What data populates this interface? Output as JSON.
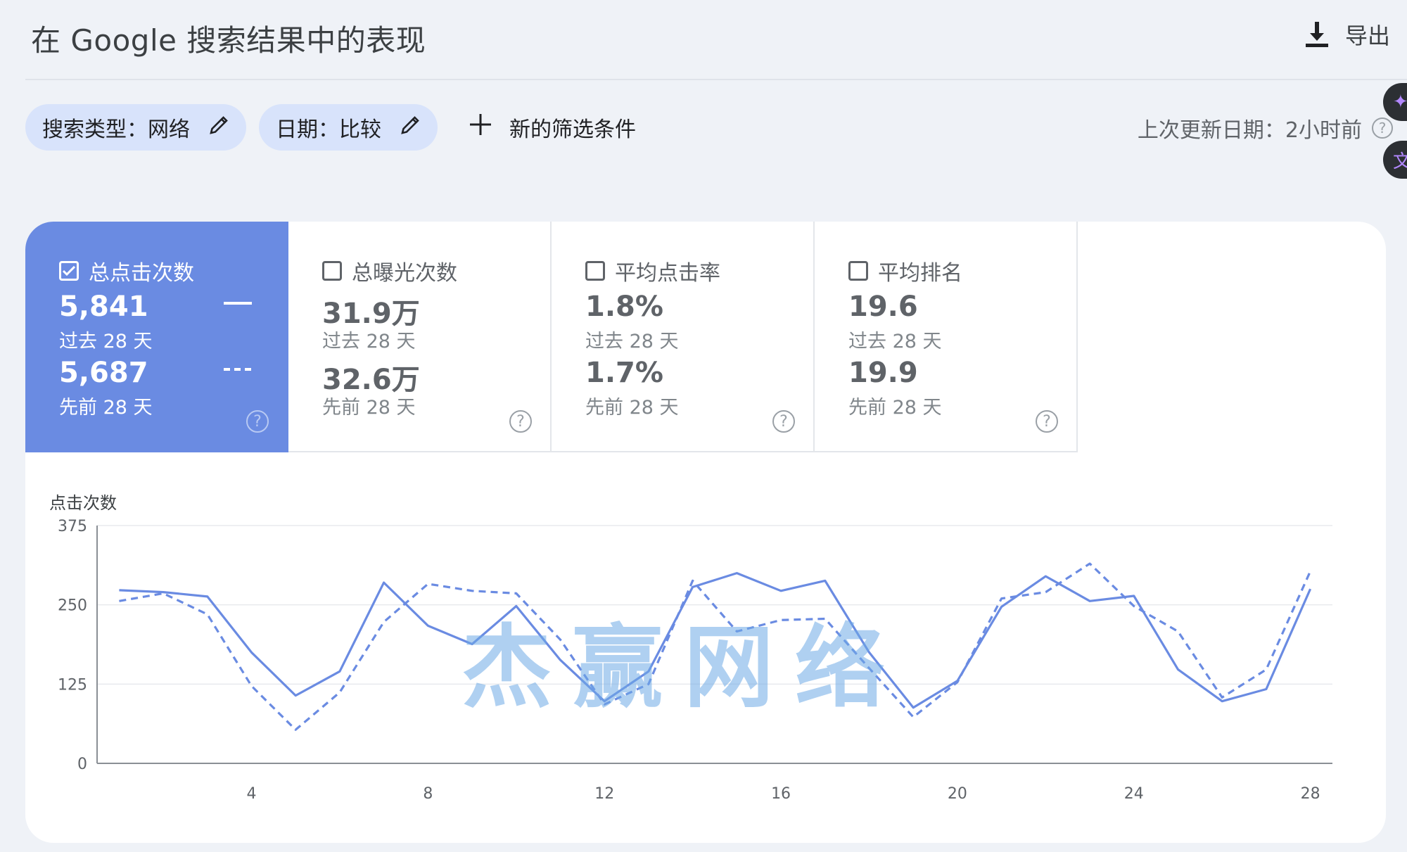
{
  "header": {
    "title": "在 Google 搜索结果中的表现",
    "export_label": "导出",
    "export_icon": "download-icon"
  },
  "filters": {
    "search_type_label": "搜索类型：网络",
    "date_label": "日期：比较",
    "add_filter_label": "新的筛选条件",
    "last_update_label": "上次更新日期：2小时前"
  },
  "metrics": [
    {
      "label": "总点击次数",
      "current": "5,841",
      "current_period": "过去 28 天",
      "previous": "5,687",
      "previous_period": "先前 28 天",
      "checked": true
    },
    {
      "label": "总曝光次数",
      "current": "31.9万",
      "current_period": "过去 28 天",
      "previous": "32.6万",
      "previous_period": "先前 28 天",
      "checked": false
    },
    {
      "label": "平均点击率",
      "current": "1.8%",
      "current_period": "过去 28 天",
      "previous": "1.7%",
      "previous_period": "先前 28 天",
      "checked": false
    },
    {
      "label": "平均排名",
      "current": "19.6",
      "current_period": "过去 28 天",
      "previous": "19.9",
      "previous_period": "先前 28 天",
      "checked": false
    }
  ],
  "watermark": "杰赢网络",
  "colors": {
    "accent": "#6a8be2",
    "line": "#6a8be2",
    "background": "#eff2f7"
  },
  "chart_data": {
    "type": "line",
    "ylabel": "点击次数",
    "ylim": [
      0,
      375
    ],
    "yticks": [
      0,
      125,
      250,
      375
    ],
    "xticks": [
      4,
      8,
      12,
      16,
      20,
      24,
      28
    ],
    "x": [
      1,
      2,
      3,
      4,
      5,
      6,
      7,
      8,
      9,
      10,
      11,
      12,
      13,
      14,
      15,
      16,
      17,
      18,
      19,
      20,
      21,
      22,
      23,
      24,
      25,
      26,
      27,
      28
    ],
    "series": [
      {
        "style": "solid",
        "values": [
          273,
          270,
          263,
          175,
          107,
          145,
          285,
          217,
          188,
          248,
          163,
          98,
          145,
          278,
          300,
          272,
          288,
          175,
          88,
          130,
          247,
          295,
          256,
          264,
          148,
          98,
          117,
          275
        ]
      },
      {
        "style": "dashed",
        "values": [
          256,
          268,
          235,
          122,
          53,
          112,
          223,
          283,
          272,
          268,
          195,
          93,
          125,
          288,
          208,
          226,
          228,
          150,
          73,
          128,
          260,
          270,
          315,
          248,
          208,
          104,
          148,
          303
        ]
      }
    ]
  }
}
